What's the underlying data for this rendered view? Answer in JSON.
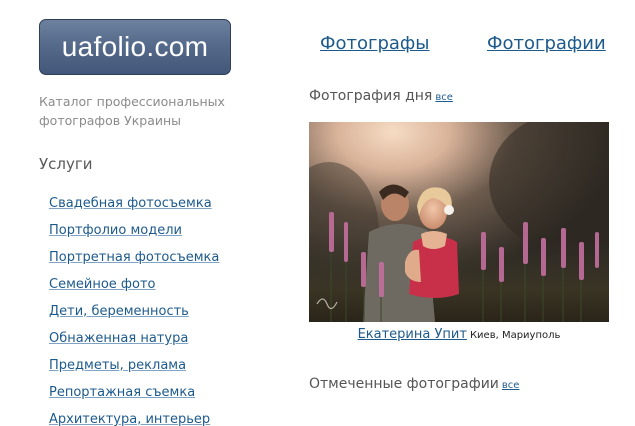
{
  "logo": {
    "text": "uafolio.com"
  },
  "tagline": "Каталог профессиональных фотографов Украины",
  "services": {
    "heading": "Услуги",
    "items": [
      "Свадебная фотосъемка",
      "Портфолио модели",
      "Портретная фотосъемка",
      "Семейное фото",
      "Дети, беременность",
      "Обнаженная натура",
      "Предметы, реклама",
      "Репортажная съемка",
      "Архитектура, интерьер"
    ]
  },
  "top_nav": {
    "photographers": "Фотографы",
    "photos": "Фотографии"
  },
  "photo_of_day": {
    "title": "Фотография дня",
    "all_link": "все",
    "author": "Екатерина Упит",
    "location": "Киев, Мариуполь"
  },
  "featured": {
    "title": "Отмеченные фотографии",
    "all_link": "все"
  }
}
